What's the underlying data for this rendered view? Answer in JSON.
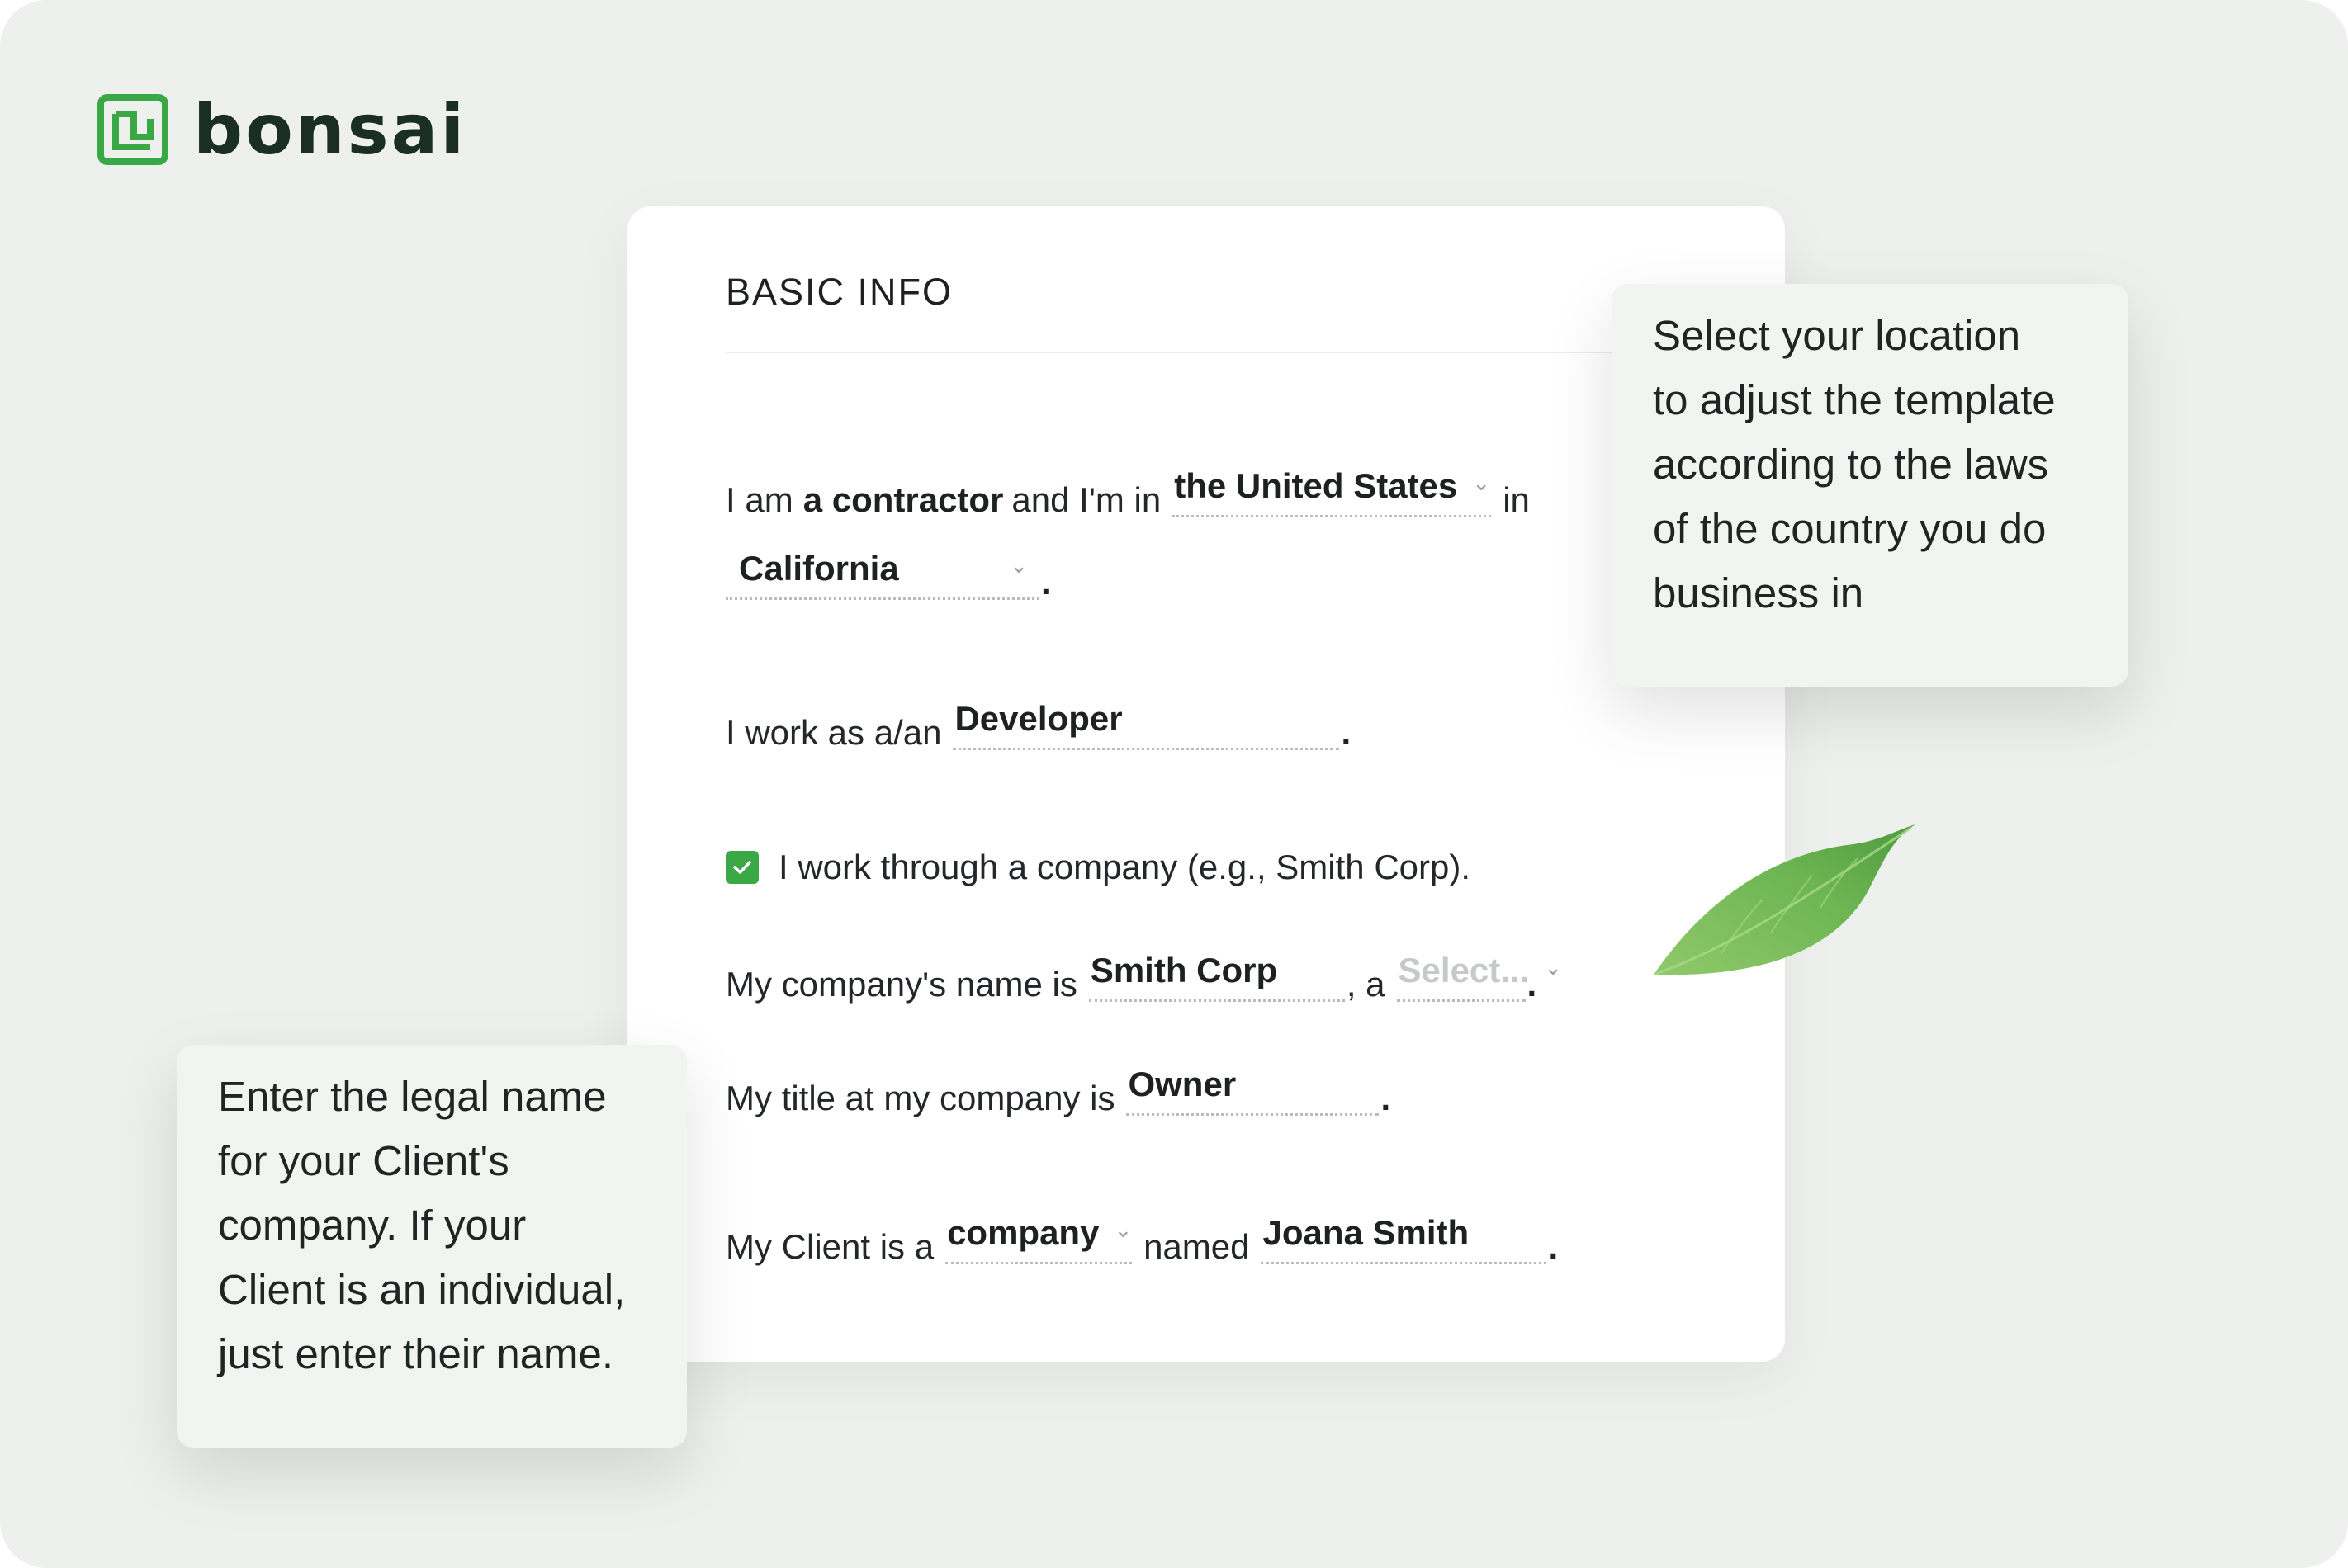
{
  "brand": {
    "name": "bonsai",
    "color": "#3aa845"
  },
  "card": {
    "title": "BASIC INFO",
    "row1": {
      "prefix": "I am",
      "role": "a contractor",
      "mid": "and I'm in",
      "country": "the United States",
      "suffix": "in"
    },
    "row2": {
      "state": "California",
      "end": "."
    },
    "row3": {
      "prefix": "I work as a/an",
      "occupation": "Developer",
      "end": "."
    },
    "row4": {
      "checkbox_checked": true,
      "label": "I work through a company (e.g., Smith Corp)."
    },
    "row5": {
      "prefix": "My company's name is",
      "company_name": "Smith Corp",
      "sep": ", a",
      "entity_placeholder": "Select...",
      "end": "."
    },
    "row6": {
      "prefix": "My title at my company is",
      "title": "Owner",
      "end": "."
    },
    "row7": {
      "prefix": "My Client is a",
      "client_type": "company",
      "mid": "named",
      "client_name": "Joana Smith",
      "end": "."
    }
  },
  "tooltips": {
    "location": [
      "Select your location",
      "to adjust the template",
      "according to the laws",
      "of the country you do",
      "business in"
    ],
    "client": [
      "Enter the legal name",
      "for your Client's",
      "company. If your",
      "Client is an individual,",
      "just enter their name."
    ]
  },
  "icons": {
    "logo": "bonsai-logo-icon",
    "chevron": "chevron-down-icon",
    "check": "check-icon",
    "leaf": "leaf-icon"
  }
}
